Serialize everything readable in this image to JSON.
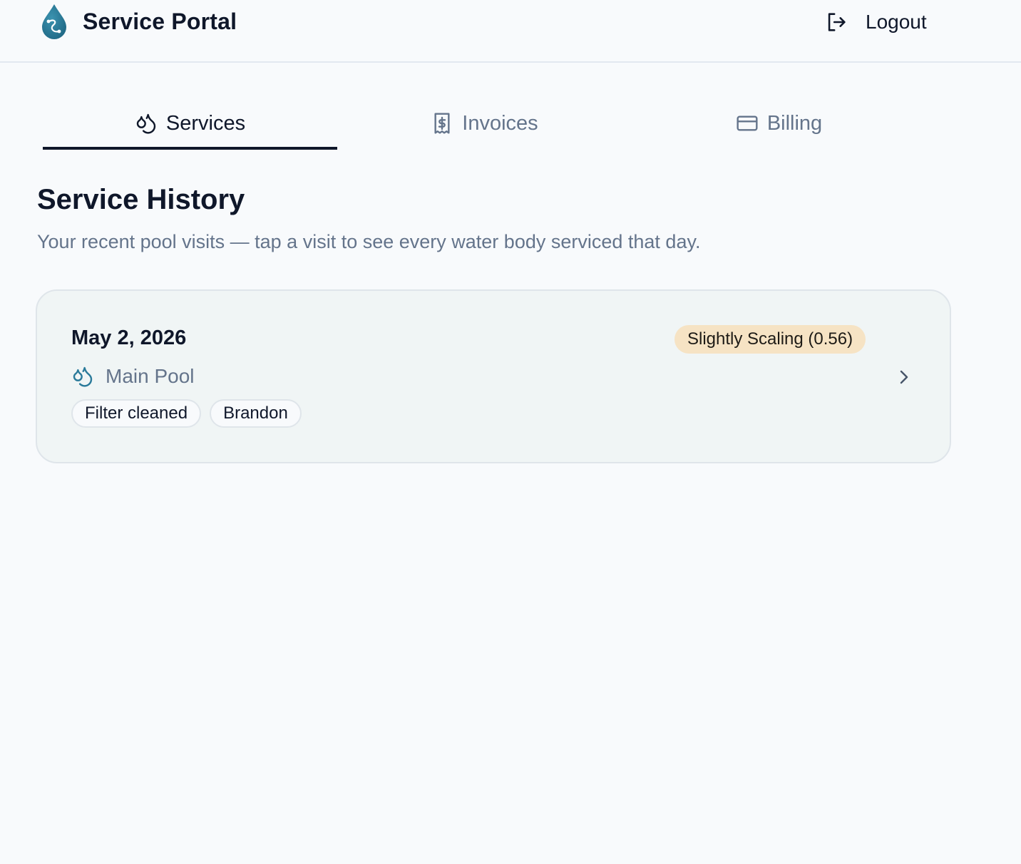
{
  "header": {
    "title": "Service Portal",
    "logo_icon": "water-drop-logo",
    "logout_label": "Logout",
    "logout_icon": "logout-icon"
  },
  "tabs": [
    {
      "label": "Services",
      "icon": "droplets-icon",
      "active": true
    },
    {
      "label": "Invoices",
      "icon": "receipt-icon",
      "active": false
    },
    {
      "label": "Billing",
      "icon": "credit-card-icon",
      "active": false
    }
  ],
  "page": {
    "title": "Service History",
    "subtitle": "Your recent pool visits — tap a visit to see every water body serviced that day."
  },
  "visits": [
    {
      "date": "May 2, 2026",
      "status": "Slightly Scaling (0.56)",
      "water_body": "Main Pool",
      "tags": [
        "Filter cleaned",
        "Brandon"
      ]
    }
  ],
  "colors": {
    "background": "#f8fafc",
    "text_primary": "#0f172a",
    "text_muted": "#64748b",
    "card_background": "#f0f5f5",
    "badge_background": "#f6e3c4",
    "brand_accent": "#2a7a9a"
  }
}
